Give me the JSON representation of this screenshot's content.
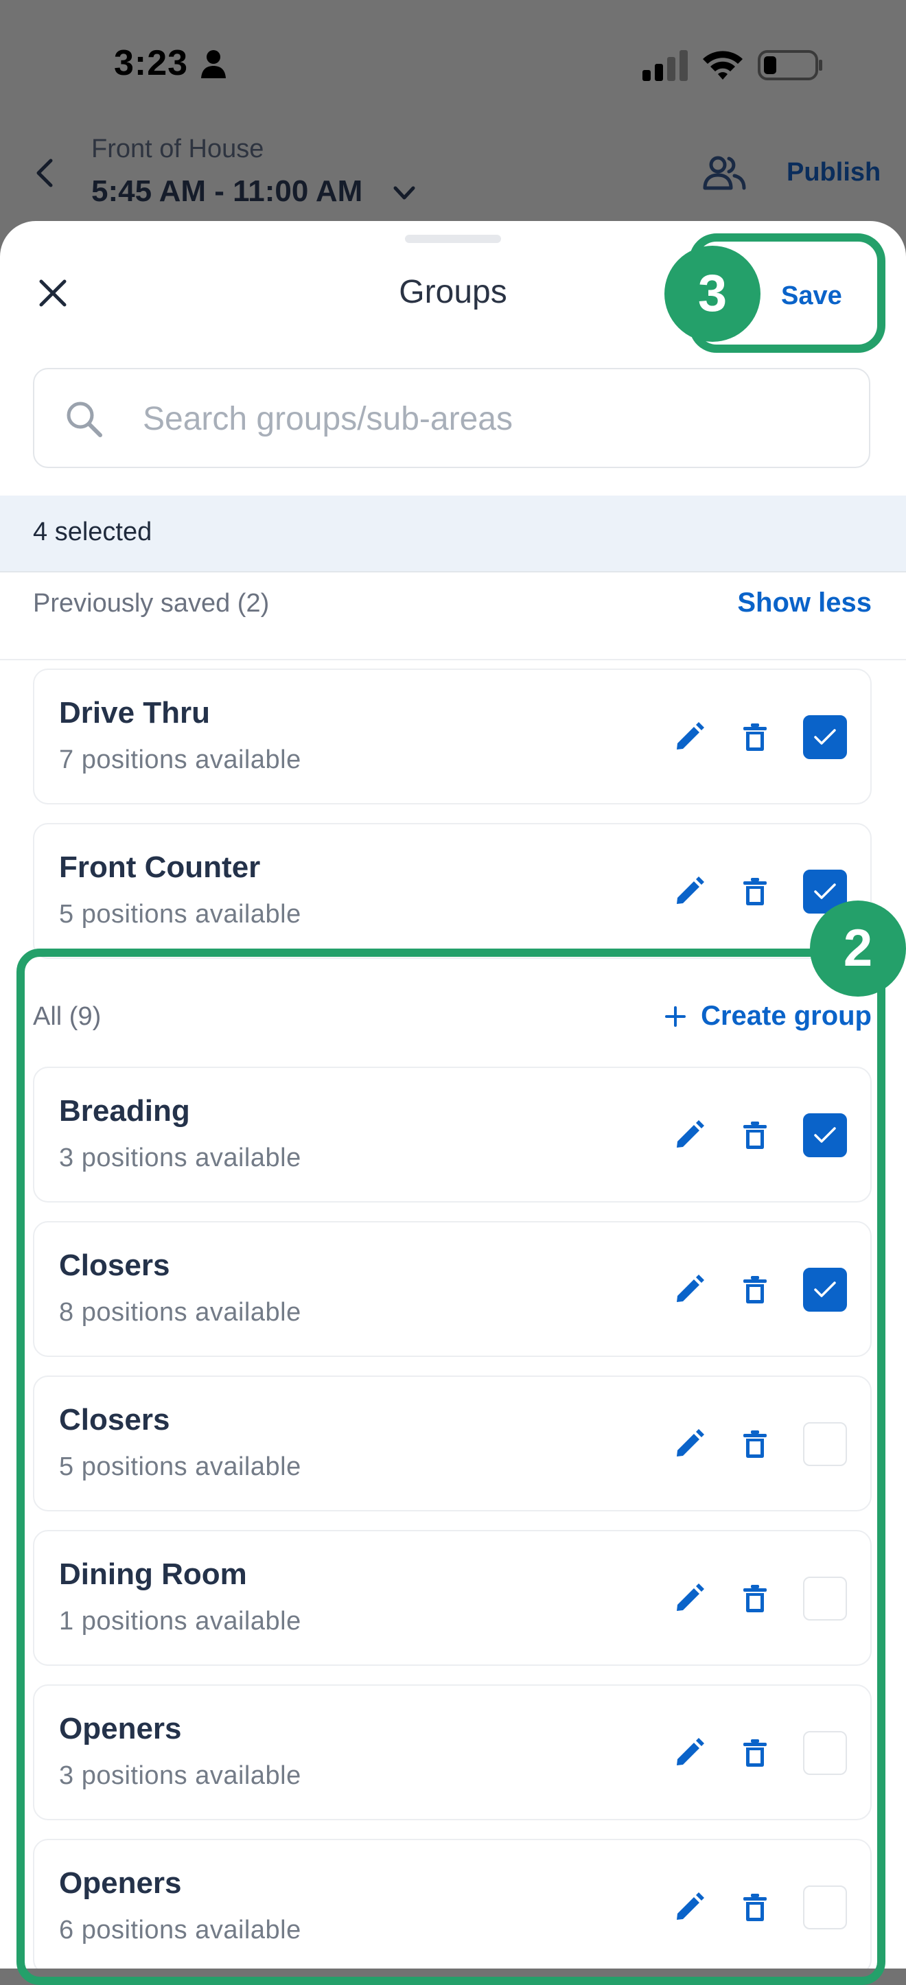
{
  "status_bar": {
    "time": "3:23",
    "icons": [
      "person-icon",
      "signal-icon",
      "wifi-icon",
      "battery-icon"
    ]
  },
  "header": {
    "subtitle": "Front of House",
    "title": "5:45 AM - 11:00 AM",
    "publish_label": "Publish"
  },
  "sheet": {
    "title": "Groups",
    "save_label": "Save",
    "search": {
      "placeholder": "Search groups/sub-areas",
      "value": ""
    },
    "selected_text": "4 selected",
    "previously_saved": {
      "label": "Previously saved (2)",
      "action": "Show less",
      "items": [
        {
          "name": "Drive Thru",
          "sub": "7 positions available",
          "checked": true
        },
        {
          "name": "Front Counter",
          "sub": "5 positions available",
          "checked": true
        }
      ]
    },
    "all": {
      "label": "All (9)",
      "action": "Create group",
      "items": [
        {
          "name": "Breading",
          "sub": "3 positions available",
          "checked": true
        },
        {
          "name": "Closers",
          "sub": "8 positions available",
          "checked": true
        },
        {
          "name": "Closers",
          "sub": "5 positions available",
          "checked": false
        },
        {
          "name": "Dining Room",
          "sub": "1 positions available",
          "checked": false
        },
        {
          "name": "Openers",
          "sub": "3 positions available",
          "checked": false
        },
        {
          "name": "Openers",
          "sub": "6 positions available",
          "checked": false
        }
      ]
    }
  },
  "annotations": {
    "badge_save": "3",
    "badge_all": "2"
  },
  "colors": {
    "accent": "#0a63c9",
    "annotation": "#24a06a",
    "overlay": "#727272"
  }
}
